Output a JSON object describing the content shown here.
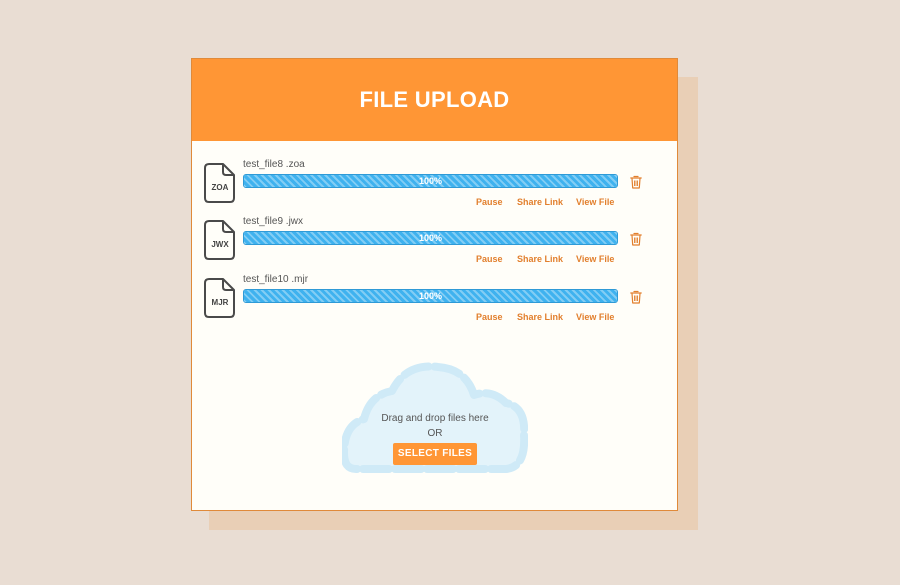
{
  "header": {
    "title": "FILE UPLOAD"
  },
  "files": [
    {
      "name": "test_file8 .zoa",
      "ext": "ZOA",
      "progress_label": "100%",
      "progress_fraction": 1.0,
      "actions": {
        "pause": "Pause",
        "share": "Share Link",
        "view": "View File"
      }
    },
    {
      "name": "test_file9 .jwx",
      "ext": "JWX",
      "progress_label": "100%",
      "progress_fraction": 1.0,
      "actions": {
        "pause": "Pause",
        "share": "Share Link",
        "view": "View File"
      }
    },
    {
      "name": "test_file10 .mjr",
      "ext": "MJR",
      "progress_label": "100%",
      "progress_fraction": 1.0,
      "actions": {
        "pause": "Pause",
        "share": "Share Link",
        "view": "View File"
      }
    }
  ],
  "dropzone": {
    "instruction": "Drag and drop files here",
    "or_text": "OR",
    "button_label": "SELECT FILES"
  },
  "icons": {
    "file": "file-icon",
    "delete": "trash-icon",
    "dropzone": "cloud-icon"
  },
  "colors": {
    "accent": "#ff9635",
    "progress": "#3fb2ef",
    "background": "#e9ddd3",
    "card": "#fffef9",
    "cloud": "#d8eff9"
  }
}
